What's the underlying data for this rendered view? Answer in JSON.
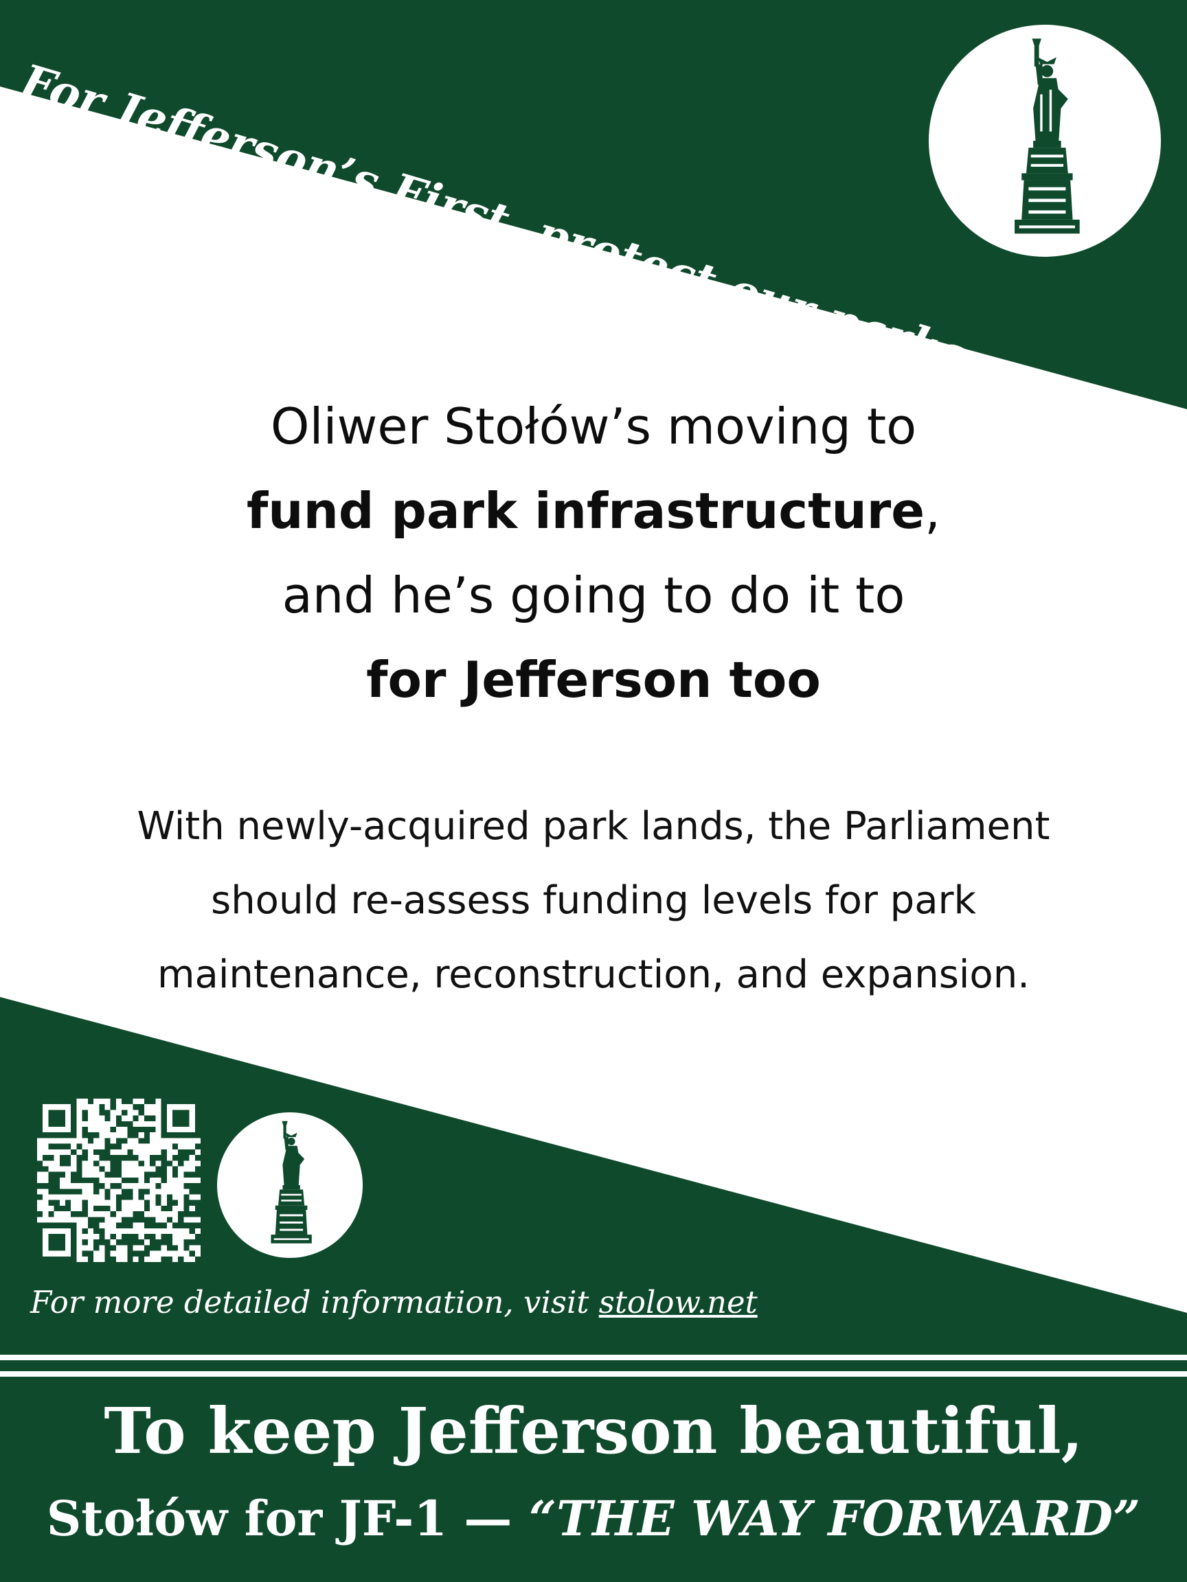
{
  "colors": {
    "green": "#0f4a2d",
    "white": "#ffffff",
    "text": "#0d0d0d"
  },
  "banner": {
    "text": "For Jefferson’s First, protect our parks…"
  },
  "emblem": {
    "icon": "statue-of-liberty-icon"
  },
  "headline": {
    "line1": "Oliwer Stołów’s moving to",
    "line2_bold": "fund park infrastructure",
    "line2_rest": ",",
    "line3": "and he’s going to do it to",
    "line4_bold": "for Jefferson too"
  },
  "body": {
    "line1": "With newly-acquired park lands, the Parliament",
    "line2": "should re-assess funding levels for park",
    "line3": "maintenance, reconstruction, and expansion."
  },
  "qr": {
    "icon": "qr-code-icon"
  },
  "info": {
    "prefix": "For more detailed information, visit ",
    "link": "stolow.net"
  },
  "footer": {
    "line1": "To keep Jefferson beautiful,",
    "line2_prefix": "Stołów for JF-1 — ",
    "line2_slogan": "“THE WAY FORWARD”"
  }
}
